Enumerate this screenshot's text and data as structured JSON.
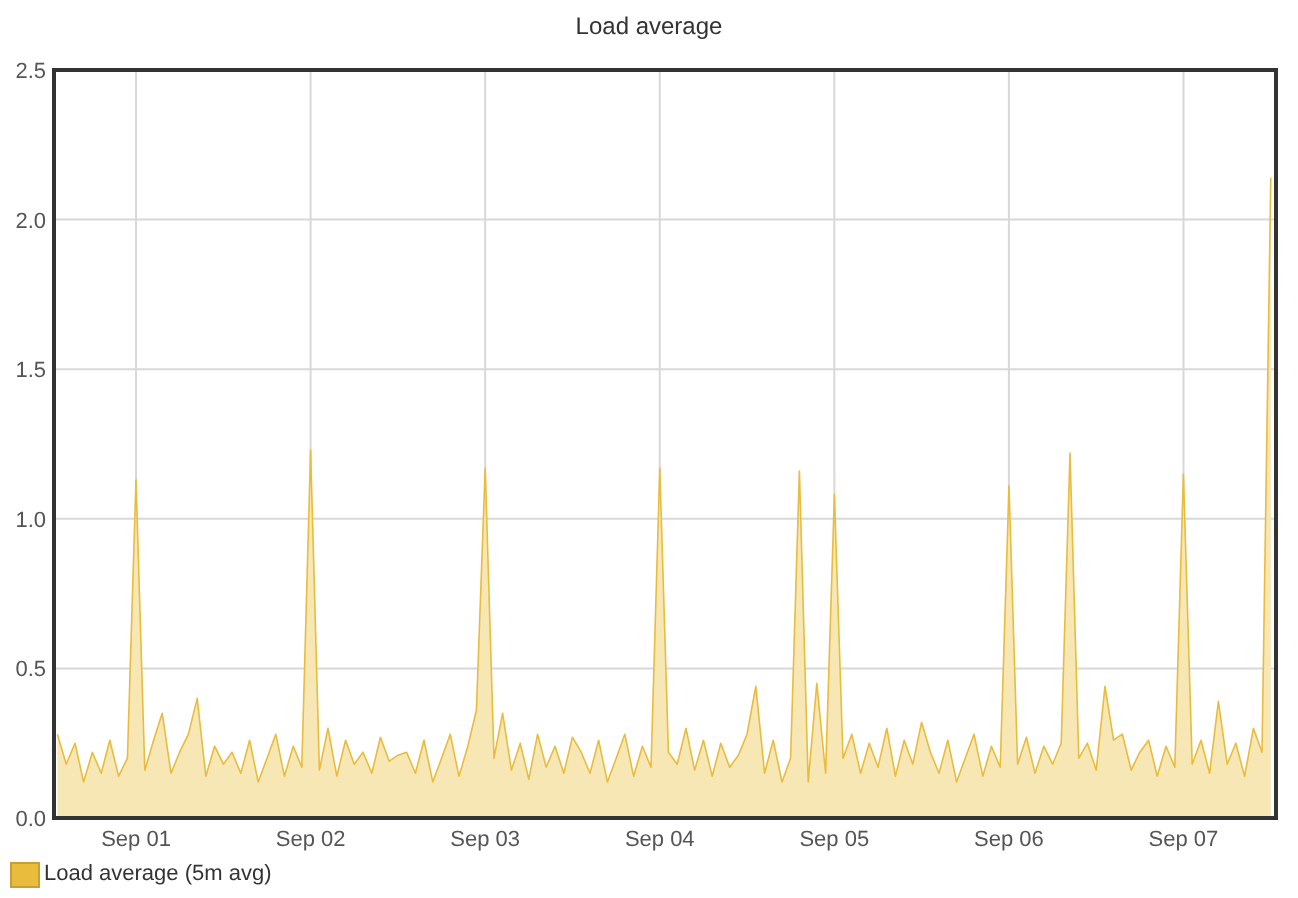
{
  "chart": {
    "chart_data": {
      "type": "area",
      "title": "Load average",
      "categories": [
        null,
        null,
        null,
        null,
        null,
        null,
        null,
        null,
        null,
        "Sep 01",
        null,
        null,
        null,
        null,
        null,
        null,
        null,
        null,
        null,
        null,
        null,
        null,
        null,
        null,
        null,
        null,
        null,
        null,
        null,
        "Sep 02",
        null,
        null,
        null,
        null,
        null,
        null,
        null,
        null,
        null,
        null,
        null,
        null,
        null,
        null,
        null,
        null,
        null,
        null,
        null,
        "Sep 03",
        null,
        null,
        null,
        null,
        null,
        null,
        null,
        null,
        null,
        null,
        null,
        null,
        null,
        null,
        null,
        null,
        null,
        null,
        null,
        "Sep 04",
        null,
        null,
        null,
        null,
        null,
        null,
        null,
        null,
        null,
        null,
        null,
        null,
        null,
        null,
        null,
        null,
        null,
        null,
        null,
        "Sep 05",
        null,
        null,
        null,
        null,
        null,
        null,
        null,
        null,
        null,
        null,
        null,
        null,
        null,
        null,
        null,
        null,
        null,
        null,
        null,
        "Sep 06",
        null,
        null,
        null,
        null,
        null,
        null,
        null,
        null,
        null,
        null,
        null,
        null,
        null,
        null,
        null,
        null,
        null,
        null,
        null,
        "Sep 07",
        null,
        null,
        null,
        null,
        null,
        null,
        null,
        null,
        null,
        null
      ],
      "series": [
        {
          "name": "Load average (5m avg)",
          "color": "#e9bc3d",
          "values": [
            0.28,
            0.18,
            0.25,
            0.12,
            0.22,
            0.15,
            0.26,
            0.14,
            0.2,
            1.13,
            0.16,
            0.26,
            0.35,
            0.15,
            0.22,
            0.28,
            0.4,
            0.14,
            0.24,
            0.18,
            0.22,
            0.15,
            0.26,
            0.12,
            0.2,
            0.28,
            0.14,
            0.24,
            0.17,
            1.23,
            0.16,
            0.3,
            0.14,
            0.26,
            0.18,
            0.22,
            0.15,
            0.27,
            0.19,
            0.21,
            0.22,
            0.15,
            0.26,
            0.12,
            0.2,
            0.28,
            0.14,
            0.24,
            0.36,
            1.17,
            0.2,
            0.35,
            0.16,
            0.25,
            0.13,
            0.28,
            0.17,
            0.24,
            0.15,
            0.27,
            0.22,
            0.15,
            0.26,
            0.12,
            0.2,
            0.28,
            0.14,
            0.24,
            0.17,
            1.17,
            0.22,
            0.18,
            0.3,
            0.16,
            0.26,
            0.14,
            0.25,
            0.17,
            0.21,
            0.28,
            0.44,
            0.15,
            0.26,
            0.12,
            0.2,
            1.16,
            0.12,
            0.45,
            0.15,
            1.08,
            0.2,
            0.28,
            0.15,
            0.25,
            0.17,
            0.3,
            0.14,
            0.26,
            0.18,
            0.32,
            0.22,
            0.15,
            0.26,
            0.12,
            0.2,
            0.28,
            0.14,
            0.24,
            0.17,
            1.11,
            0.18,
            0.27,
            0.15,
            0.24,
            0.18,
            0.25,
            1.22,
            0.2,
            0.25,
            0.16,
            0.44,
            0.26,
            0.28,
            0.16,
            0.22,
            0.26,
            0.14,
            0.24,
            0.17,
            1.15,
            0.18,
            0.26,
            0.15,
            0.39,
            0.18,
            0.25,
            0.14,
            0.3,
            0.22,
            2.14
          ]
        }
      ],
      "ylim": [
        0,
        2.5
      ],
      "grid": true,
      "yticks": [
        {
          "value": 0,
          "label": "0.0"
        },
        {
          "value": 0.5,
          "label": "0.5"
        },
        {
          "value": 1,
          "label": "1.0"
        },
        {
          "value": 1.5,
          "label": "1.5"
        },
        {
          "value": 2,
          "label": "2.0"
        },
        {
          "value": 2.5,
          "label": "2.5"
        }
      ]
    }
  }
}
